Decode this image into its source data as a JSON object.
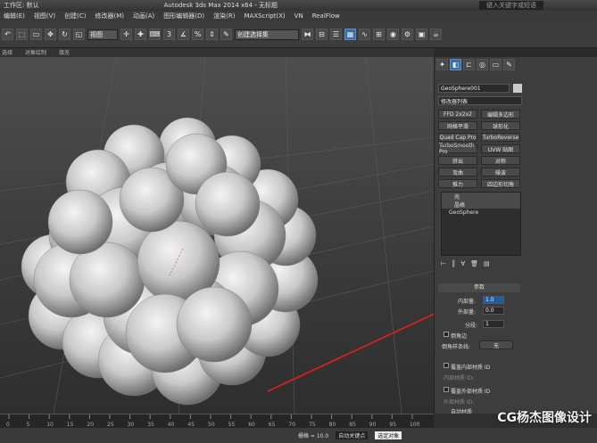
{
  "title": {
    "workspace": "工作区: 默认",
    "app": "Autodesk 3ds Max 2014 x64 - 无标题",
    "search": "键入关键字或短语"
  },
  "menu": [
    "编辑(E)",
    "视图(V)",
    "创建(C)",
    "修改器(M)",
    "动画(A)",
    "图形编辑器(D)",
    "渲染(R)",
    "MAXScript(X)",
    "VN",
    "RealFlow"
  ],
  "toolbar": {
    "view_combo": "视图",
    "selset_combo": "创建选择集",
    "pct": "3"
  },
  "subbar": [
    "选择",
    "对象绘制",
    "填充"
  ],
  "cmd": {
    "object_name": "GeoSphere001",
    "modifier_list": "修改器列表",
    "buttons": [
      "FFD 2x2x2",
      "编辑多边形",
      "网格平滑",
      "球形化",
      "Quad Cap Pro",
      "TurboReverse",
      "TurboSmooth Pro",
      "UVW 贴图",
      "挤出",
      "对称",
      "弯曲",
      "噪波",
      "推力",
      "四边形切角"
    ],
    "stack": [
      "壳",
      "晶格",
      "GeoSphere"
    ],
    "rollout": "参数",
    "inner_label": "内部量:",
    "inner_val": "1.0",
    "outer_label": "外部量:",
    "outer_val": "0.0",
    "seg_label": "分段:",
    "seg_val": "1",
    "bevel_edges": "倒角边",
    "bevel_spline_label": "倒角样条线:",
    "bevel_spline_val": "无",
    "override_inner": "覆盖内部材质 ID",
    "inner_id_label": "内部材质 ID:",
    "override_outer": "覆盖外部材质 ID",
    "outer_id_label": "外部材质 ID:",
    "auto_mat": "自动材质"
  },
  "timeline": {
    "ticks": [
      "0",
      "5",
      "10",
      "15",
      "20",
      "25",
      "30",
      "35",
      "40",
      "45",
      "50",
      "55",
      "60",
      "65",
      "70",
      "75",
      "80",
      "85",
      "90",
      "95",
      "100"
    ]
  },
  "status": {
    "grid": "栅格 = 10.0",
    "autokey": "自动关键点",
    "selected": "选定对象"
  },
  "watermark": "CG杨杰图像设计"
}
